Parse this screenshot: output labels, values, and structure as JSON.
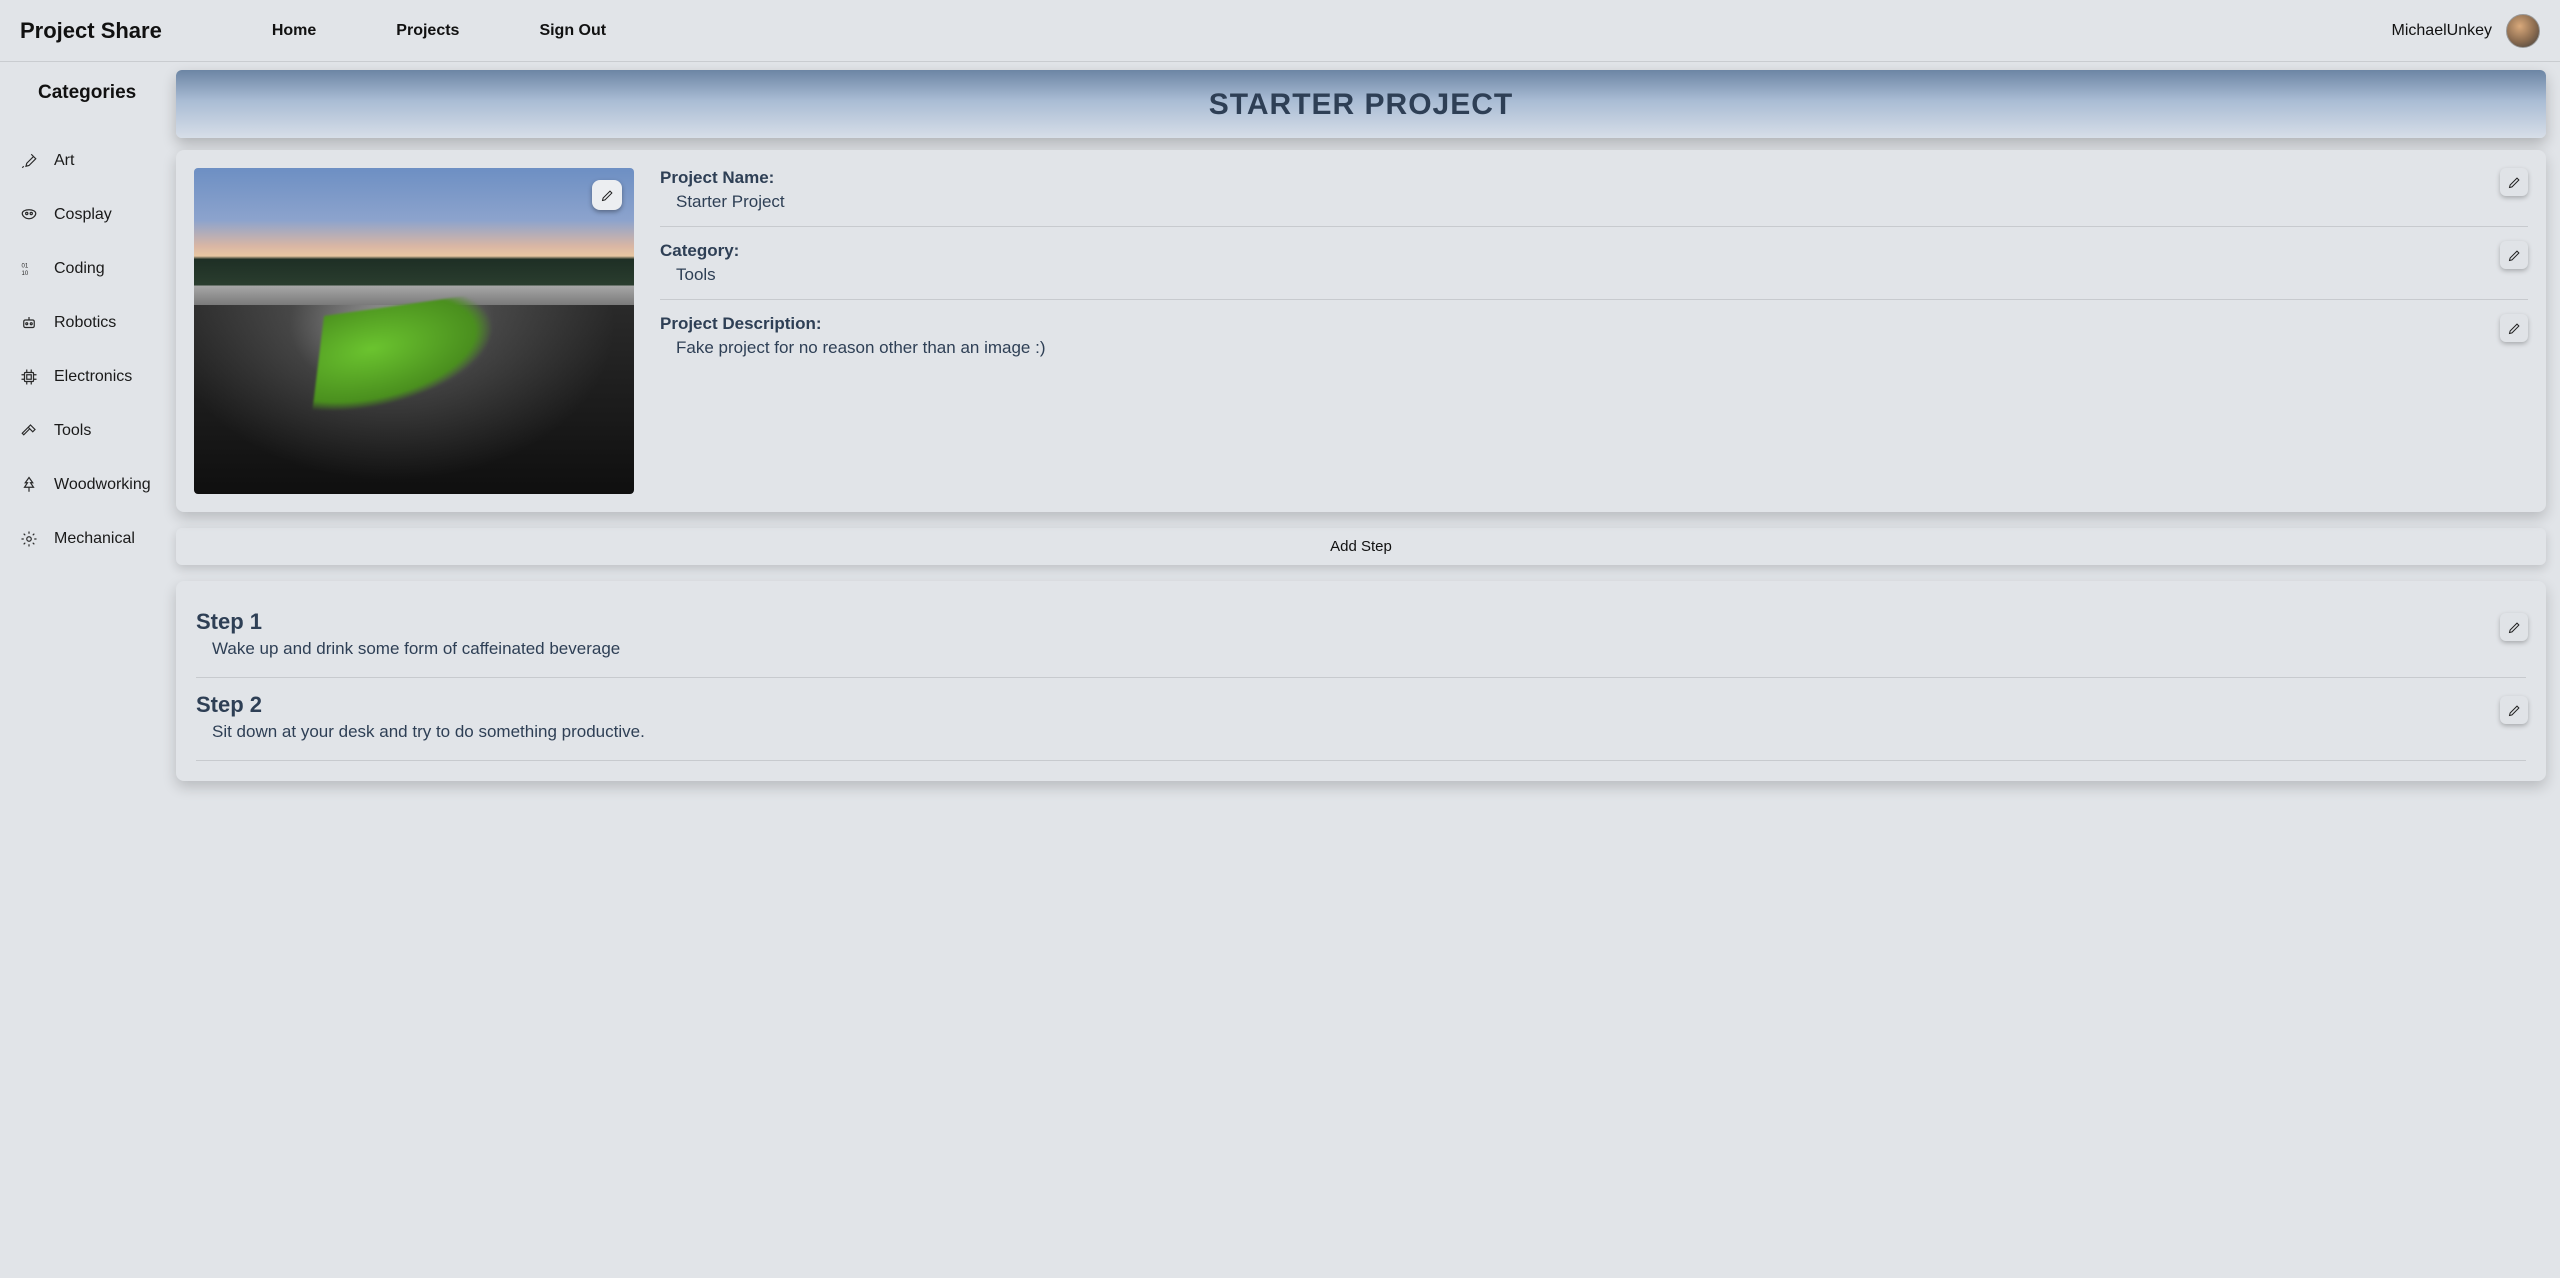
{
  "brand": "Project Share",
  "nav": {
    "home": "Home",
    "projects": "Projects",
    "signout": "Sign Out"
  },
  "user": {
    "name": "MichaelUnkey"
  },
  "sidebar": {
    "title": "Categories",
    "items": [
      {
        "label": "Art",
        "icon": "brush-icon"
      },
      {
        "label": "Cosplay",
        "icon": "mask-icon"
      },
      {
        "label": "Coding",
        "icon": "binary-icon"
      },
      {
        "label": "Robotics",
        "icon": "robot-icon"
      },
      {
        "label": "Electronics",
        "icon": "chip-icon"
      },
      {
        "label": "Tools",
        "icon": "hammer-icon"
      },
      {
        "label": "Woodworking",
        "icon": "tree-icon"
      },
      {
        "label": "Mechanical",
        "icon": "gear-icon"
      }
    ]
  },
  "page_title": "STARTER PROJECT",
  "project": {
    "name_label": "Project Name:",
    "name_value": "Starter Project",
    "category_label": "Category:",
    "category_value": "Tools",
    "description_label": "Project Description:",
    "description_value": "Fake project for no reason other than an image :)"
  },
  "add_step_label": "Add Step",
  "steps": [
    {
      "title": "Step 1",
      "text": "Wake up and drink some form of caffeinated beverage"
    },
    {
      "title": "Step 2",
      "text": "Sit down at your desk and try to do something productive."
    }
  ]
}
